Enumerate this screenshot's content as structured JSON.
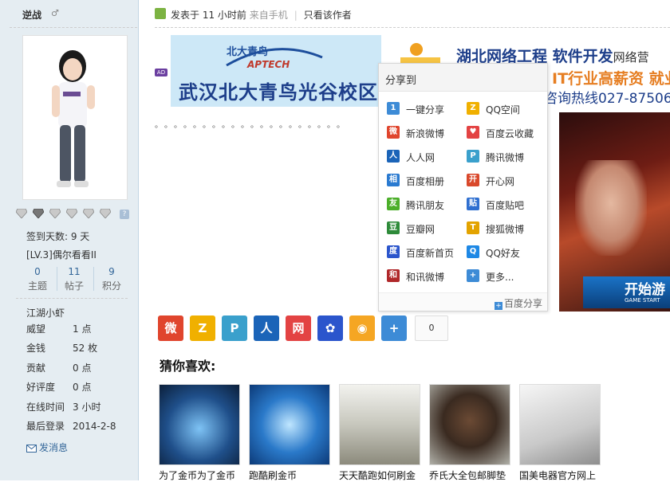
{
  "user": {
    "name": "逆战",
    "sex_mark": "♂",
    "signin": "签到天数: 9 天",
    "level": "[LV.3]偶尔看看II",
    "stats": [
      {
        "value": "0",
        "label": "主题"
      },
      {
        "value": "11",
        "label": "帖子"
      },
      {
        "value": "9",
        "label": "积分"
      }
    ],
    "group": "江湖小虾",
    "fields": [
      {
        "k": "威望",
        "v": "1 点"
      },
      {
        "k": "金钱",
        "v": "52 枚"
      },
      {
        "k": "贡献",
        "v": "0 点"
      },
      {
        "k": "好评度",
        "v": "0 点"
      },
      {
        "k": "在线时间",
        "v": "3 小时"
      },
      {
        "k": "最后登录",
        "v": "2014-2-8"
      }
    ],
    "send_msg": "发消息"
  },
  "post": {
    "posted": "发表于 11 小时前",
    "source": "来自手机",
    "only_author": "只看该作者",
    "ad_badge": "AD",
    "dots": "。。。。。。。。。。。。。。。。。。。。"
  },
  "ad1": {
    "brand": "北大青鸟",
    "aptech": "APTECH",
    "campus": "武汉北大青鸟光谷校区"
  },
  "ad2": {
    "line1": "湖北网络工程 软件开发",
    "line1_tail": "网络营",
    "line2": "IT行业高薪资 就业",
    "line3": "咨询热线027-87506"
  },
  "game": {
    "start": "开始游",
    "sub": "GAME START"
  },
  "share": {
    "title": "分享到",
    "items": [
      {
        "label": "一键分享",
        "icon": "1",
        "color": "#3d8bd6"
      },
      {
        "label": "QQ空间",
        "icon": "Z",
        "color": "#f0b000"
      },
      {
        "label": "新浪微博",
        "icon": "微",
        "color": "#e0452d"
      },
      {
        "label": "百度云收藏",
        "icon": "♥",
        "color": "#e34343"
      },
      {
        "label": "人人网",
        "icon": "人",
        "color": "#1b64b8"
      },
      {
        "label": "腾讯微博",
        "icon": "P",
        "color": "#3aa0cc"
      },
      {
        "label": "百度相册",
        "icon": "相",
        "color": "#2a7ad0"
      },
      {
        "label": "开心网",
        "icon": "开",
        "color": "#d9482b"
      },
      {
        "label": "腾讯朋友",
        "icon": "友",
        "color": "#4caf2a"
      },
      {
        "label": "百度贴吧",
        "icon": "贴",
        "color": "#2f6fd0"
      },
      {
        "label": "豆瓣网",
        "icon": "豆",
        "color": "#2e8b3a"
      },
      {
        "label": "搜狐微博",
        "icon": "T",
        "color": "#e3a300"
      },
      {
        "label": "百度新首页",
        "icon": "度",
        "color": "#2b55cc"
      },
      {
        "label": "QQ好友",
        "icon": "Q",
        "color": "#1e88e5"
      },
      {
        "label": "和讯微博",
        "icon": "和",
        "color": "#b0282a"
      },
      {
        "label": "更多...",
        "icon": "+",
        "color": "#3d8bd6"
      }
    ],
    "footer": "百度分享"
  },
  "share_bar": {
    "buttons": [
      {
        "icon": "微",
        "color": "#e0452d",
        "name": "sina-weibo-icon"
      },
      {
        "icon": "Z",
        "color": "#f0b000",
        "name": "qzone-icon"
      },
      {
        "icon": "P",
        "color": "#3aa0cc",
        "name": "tencent-weibo-icon"
      },
      {
        "icon": "人",
        "color": "#1b64b8",
        "name": "renren-icon"
      },
      {
        "icon": "网",
        "color": "#e34343",
        "name": "netease-icon"
      },
      {
        "icon": "✿",
        "color": "#2b55cc",
        "name": "baidu-icon"
      },
      {
        "icon": "◉",
        "color": "#f5a623",
        "name": "location-icon"
      },
      {
        "icon": "+",
        "color": "#3d8bd6",
        "name": "more-share-icon"
      }
    ],
    "count": "0"
  },
  "guess": {
    "title": "猜你喜欢:",
    "cards": [
      {
        "caption": "为了金币为了金币",
        "color": "#1f4f8a"
      },
      {
        "caption": "跑酷刷金币",
        "color": "#2a79c9"
      },
      {
        "caption": "天天酷跑如何刷金",
        "color": "#9a9a8e"
      },
      {
        "caption": "乔氏大全包邮脚垫",
        "color": "#3a2a20"
      },
      {
        "caption": "国美电器官方网上",
        "color": "#c9c9c9"
      }
    ]
  }
}
